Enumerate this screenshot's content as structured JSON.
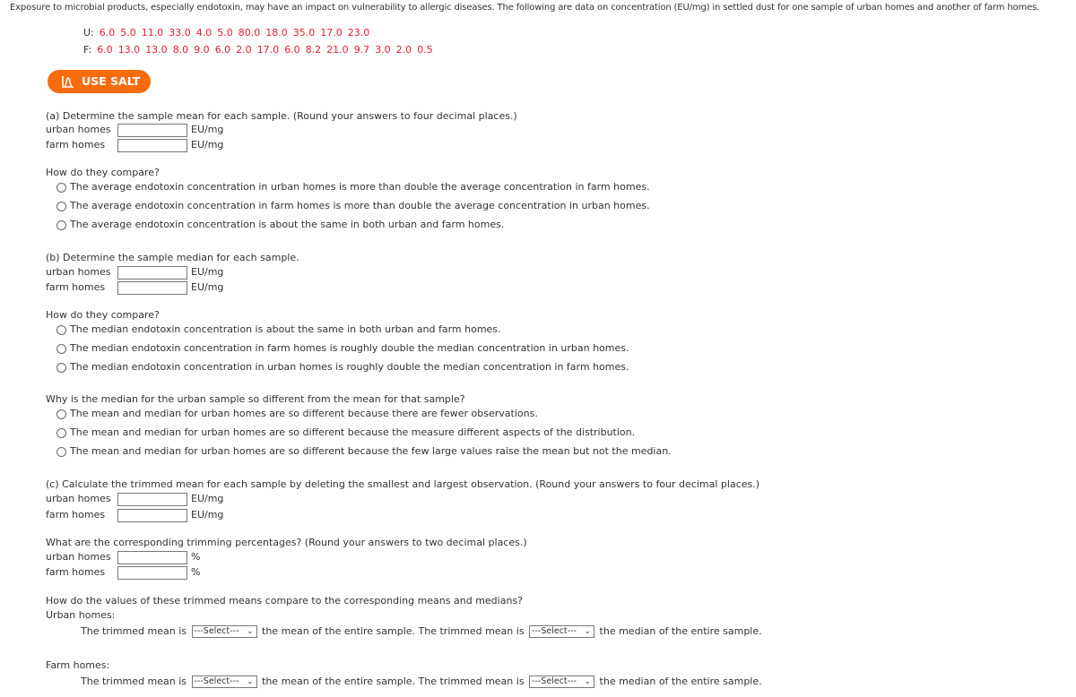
{
  "intro": "Exposure to microbial products, especially endotoxin, may have an impact on vulnerability to allergic diseases. The following are data on concentration (EU/mg) in settled dust for one sample of urban homes and another of farm homes.",
  "urban_label": "U:",
  "urban_values": [
    "6.0",
    "5.0",
    "11.0",
    "33.0",
    "4.0",
    "5.0",
    "80.0",
    "18.0",
    "35.0",
    "17.0",
    "23.0"
  ],
  "farm_label": "F:",
  "farm_values": [
    "6.0",
    "13.0",
    "13.0",
    "8.0",
    "9.0",
    "6.0",
    "2.0",
    "17.0",
    "6.0",
    "8.2",
    "21.0",
    "9.7",
    "3.0",
    "2.0",
    "0.5"
  ],
  "salt_button": "USE SALT",
  "accent": "#f96b0b",
  "row_urban": "urban homes",
  "row_farm": "farm homes",
  "unit": "EU/mg",
  "unit_pct": "%",
  "a": {
    "prompt": "(a) Determine the sample mean for each sample. (Round your answers to four decimal places.)",
    "compare": "How do they compare?",
    "options": [
      "The average endotoxin concentration in urban homes is more than double the average concentration in farm homes.",
      "The average endotoxin concentration in farm homes is more than double the average concentration in urban homes.",
      "The average endotoxin concentration is about the same in both urban and farm homes."
    ]
  },
  "b": {
    "prompt": "(b) Determine the sample median for each sample.",
    "compare": "How do they compare?",
    "options": [
      "The median endotoxin concentration is about the same in both urban and farm homes.",
      "The median endotoxin concentration in farm homes is roughly double the median concentration in urban homes.",
      "The median endotoxin concentration in urban homes is roughly double the median concentration in farm homes."
    ],
    "why": "Why is the median for the urban sample so different from the mean for that sample?",
    "why_options": [
      "The mean and median for urban homes are so different because there are fewer observations.",
      "The mean and median for urban homes are so different because the measure different aspects of the distribution.",
      "The mean and median for urban homes are so different because the few large values raise the mean but not the median."
    ]
  },
  "c": {
    "prompt": "(c) Calculate the trimmed mean for each sample by deleting the smallest and largest observation. (Round your answers to four decimal places.)",
    "pct_prompt": "What are the corresponding trimming percentages? (Round your answers to two decimal places.)",
    "compare": "How do the values of these trimmed means compare to the corresponding means and medians?",
    "urban_heading": "Urban homes:",
    "farm_heading": "Farm homes:",
    "s1": "The trimmed mean is",
    "s2": "the mean of the entire sample. The trimmed mean is",
    "s3": "the median of the entire sample.",
    "select": "---Select---"
  }
}
